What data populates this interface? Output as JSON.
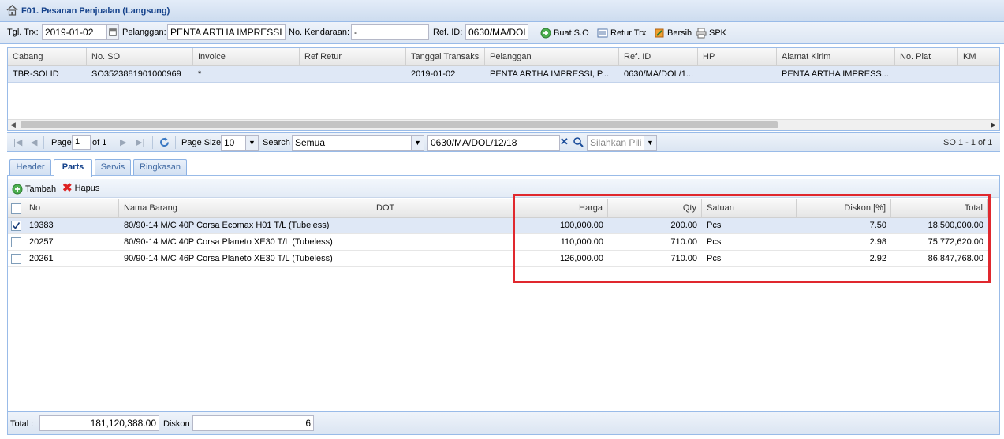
{
  "title": "F01. Pesanan Penjualan (Langsung)",
  "toolbar": {
    "tgl_label": "Tgl. Trx:",
    "tgl_value": "2019-01-02",
    "pelanggan_label": "Pelanggan:",
    "pelanggan_value": "PENTA ARTHA IMPRESSI",
    "kendaraan_label": "No. Kendaraan:",
    "kendaraan_value": "-",
    "ref_label": "Ref. ID:",
    "ref_value": "0630/MA/DOL",
    "buat_so": "Buat S.O",
    "retur_trx": "Retur Trx",
    "bersih": "Bersih",
    "spk": "SPK"
  },
  "so_grid": {
    "headers": [
      "Cabang",
      "No. SO",
      "Invoice",
      "Ref Retur",
      "Tanggal Transaksi",
      "Pelanggan",
      "Ref. ID",
      "HP",
      "Alamat Kirim",
      "No. Plat",
      "KM"
    ],
    "rows": [
      [
        "TBR-SOLID",
        "SO352388190100096​9",
        "*",
        "",
        "2019-01-02",
        "PENTA ARTHA IMPRESSI, P...",
        "0630/MA/DOL/1...",
        "",
        "PENTA ARTHA IMPRESS...",
        "",
        ""
      ]
    ]
  },
  "pager": {
    "page_label": "Page",
    "page_value": "1",
    "of_label": "of 1",
    "page_size_label": "Page Size",
    "page_size_value": "10",
    "search_label": "Search",
    "search_value": "Semua",
    "filter_value": "0630/MA/DOL/12/18",
    "select_placeholder": "Silahkan Pili",
    "summary": "SO 1 - 1 of 1"
  },
  "tabs": [
    "Header",
    "Parts",
    "Servis",
    "Ringkasan"
  ],
  "parts_toolbar": {
    "tambah": "Tambah",
    "hapus": "Hapus"
  },
  "parts_grid": {
    "headers": [
      "No",
      "Nama Barang",
      "DOT",
      "Harga",
      "Qty",
      "Satuan",
      "Diskon [%]",
      "Total"
    ],
    "rows": [
      {
        "checked": true,
        "cells": [
          "19383",
          "80/90-14 M/C 40P Corsa Ecomax H01 T/L (Tubeless)",
          "",
          "100,000.00",
          "200.00",
          "Pcs",
          "7.50",
          "18,500,000.00"
        ]
      },
      {
        "checked": false,
        "cells": [
          "20257",
          "80/90-14 M/C 40P Corsa Planeto XE30 T/L (Tubeless)",
          "",
          "110,000.00",
          "710.00",
          "Pcs",
          "2.98",
          "75,772,620.00"
        ]
      },
      {
        "checked": false,
        "cells": [
          "20261",
          "90/90-14 M/C 46P Corsa Planeto XE30 T/L (Tubeless)",
          "",
          "126,000.00",
          "710.00",
          "Pcs",
          "2.92",
          "86,847,768.00"
        ]
      }
    ]
  },
  "footer": {
    "total_label": "Total :",
    "total_value": "181,120,388.00",
    "diskon_label": "Diskon",
    "diskon_value": "6"
  },
  "colors": {
    "highlight": "#e0282e",
    "selected_row": "#dfe8f6",
    "header_blue": "#15428b"
  }
}
